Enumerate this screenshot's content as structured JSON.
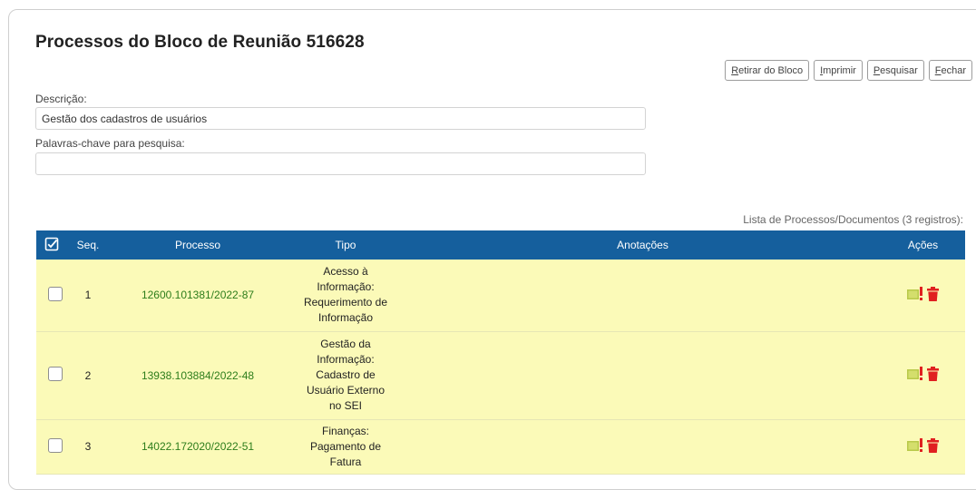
{
  "page": {
    "title": "Processos do Bloco de Reunião 516628"
  },
  "toolbar": {
    "buttons": [
      {
        "accel": "R",
        "rest": "etirar do Bloco"
      },
      {
        "accel": "I",
        "rest": "mprimir"
      },
      {
        "accel": "P",
        "rest": "esquisar"
      },
      {
        "accel": "F",
        "rest": "echar"
      }
    ]
  },
  "form": {
    "descricao_label": "Descrição:",
    "descricao_value": "Gestão dos cadastros de usuários",
    "palavras_label": "Palavras-chave para pesquisa:",
    "palavras_value": ""
  },
  "table": {
    "caption": "Lista de Processos/Documentos (3 registros):",
    "columns": {
      "seq": "Seq.",
      "processo": "Processo",
      "tipo": "Tipo",
      "anotacoes": "Anotações",
      "acoes": "Ações"
    },
    "rows": [
      {
        "seq": "1",
        "processo": "12600.101381/2022-87",
        "tipo": [
          "Acesso à",
          "Informação:",
          "Requerimento de",
          "Informação"
        ],
        "anotacoes": ""
      },
      {
        "seq": "2",
        "processo": "13938.103884/2022-48",
        "tipo": [
          "Gestão da",
          "Informação:",
          "Cadastro de",
          "Usuário Externo",
          "no SEI"
        ],
        "anotacoes": ""
      },
      {
        "seq": "3",
        "processo": "14022.172020/2022-51",
        "tipo": [
          "Finanças:",
          "Pagamento de",
          "Fatura"
        ],
        "anotacoes": ""
      }
    ]
  },
  "icons": {
    "header_check": "check-all-icon",
    "annotation": "annotation-note-icon",
    "remove": "trash-icon"
  },
  "colors": {
    "header_bg": "#155f9d",
    "row_bg": "#fbfab8",
    "link": "#2d7d1b",
    "trash": "#e02020"
  }
}
